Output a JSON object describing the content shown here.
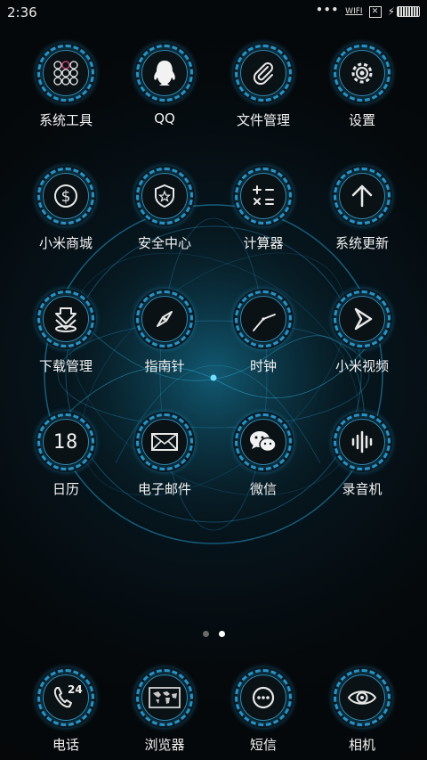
{
  "status_bar": {
    "time": "2:36",
    "dots": "•••",
    "wifi": "WIFI",
    "sim": "✕"
  },
  "apps": [
    {
      "label": "系统工具",
      "icon": "folder-grid-icon"
    },
    {
      "label": "QQ",
      "icon": "penguin-icon"
    },
    {
      "label": "文件管理",
      "icon": "paperclip-icon"
    },
    {
      "label": "设置",
      "icon": "gear-icon"
    },
    {
      "label": "小米商城",
      "icon": "dollar-icon"
    },
    {
      "label": "安全中心",
      "icon": "shield-star-icon"
    },
    {
      "label": "计算器",
      "icon": "calculator-icon"
    },
    {
      "label": "系统更新",
      "icon": "arrow-up-icon"
    },
    {
      "label": "下载管理",
      "icon": "download-icon"
    },
    {
      "label": "指南针",
      "icon": "compass-icon"
    },
    {
      "label": "时钟",
      "icon": "clock-icon"
    },
    {
      "label": "小米视频",
      "icon": "play-icon"
    },
    {
      "label": "日历",
      "icon": "calendar-icon",
      "glyph_text": "18"
    },
    {
      "label": "电子邮件",
      "icon": "envelope-icon"
    },
    {
      "label": "微信",
      "icon": "wechat-icon"
    },
    {
      "label": "录音机",
      "icon": "waveform-icon"
    }
  ],
  "pager": {
    "pages": 2,
    "current": 2
  },
  "dock": [
    {
      "label": "电话",
      "icon": "phone-24-icon",
      "glyph_text": "24"
    },
    {
      "label": "浏览器",
      "icon": "world-map-icon"
    },
    {
      "label": "短信",
      "icon": "chat-bubble-icon"
    },
    {
      "label": "相机",
      "icon": "eye-camera-icon"
    }
  ],
  "colors": {
    "accent": "#2aa9e6",
    "glow": "#3bc2ff",
    "background": "#050607"
  }
}
